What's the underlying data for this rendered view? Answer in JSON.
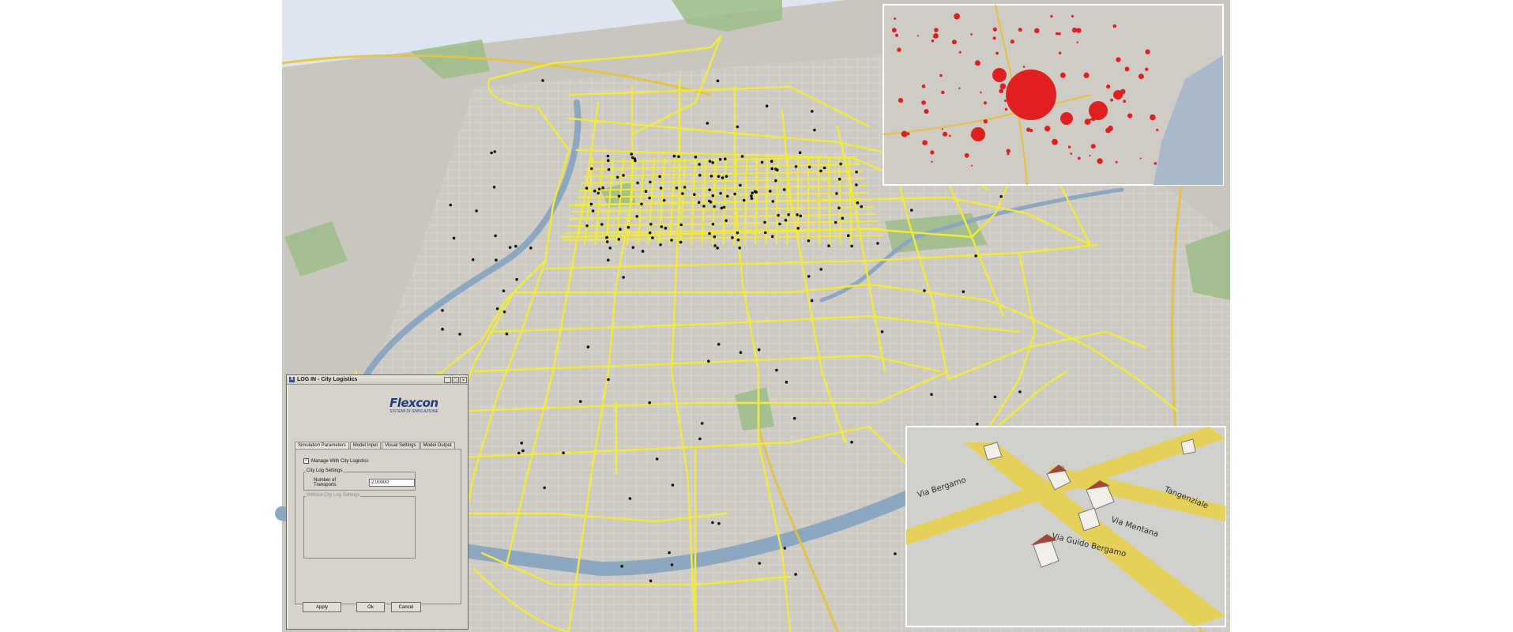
{
  "dialog": {
    "title": "LOG IN - City Logistics",
    "window_buttons": [
      "_",
      "□",
      "×"
    ],
    "app_icon": "X",
    "logo_text": "Flexcon",
    "logo_tagline": "SISTEMI DI SIMULAZIONE",
    "tabs": [
      "Simulation Parameters",
      "Model Input",
      "Visual Settings",
      "Model Output"
    ],
    "active_tab": "Simulation Parameters",
    "manage_checkbox_label": "Manage With City Logistics",
    "manage_checked": true,
    "group_city_log_settings": "City Log Settings",
    "number_of_transports_label": "Number of Transports",
    "number_of_transports_value": "2.00000",
    "group_without_city_log": "Without City Log Settings",
    "buttons": {
      "apply": "Apply",
      "ok": "Ok",
      "cancel": "Cancel"
    }
  },
  "inset_3d": {
    "street_labels": [
      "Via Bergamo",
      "Via Mentana",
      "Via Guido Bergamo",
      "Tangenziale"
    ]
  },
  "colors": {
    "network_link": "#f2ea3a",
    "node": "#111111",
    "bubble": "#e02020",
    "river": "#8ea7c0",
    "park": "#8fb67c",
    "road_main": "#e6c23b"
  }
}
